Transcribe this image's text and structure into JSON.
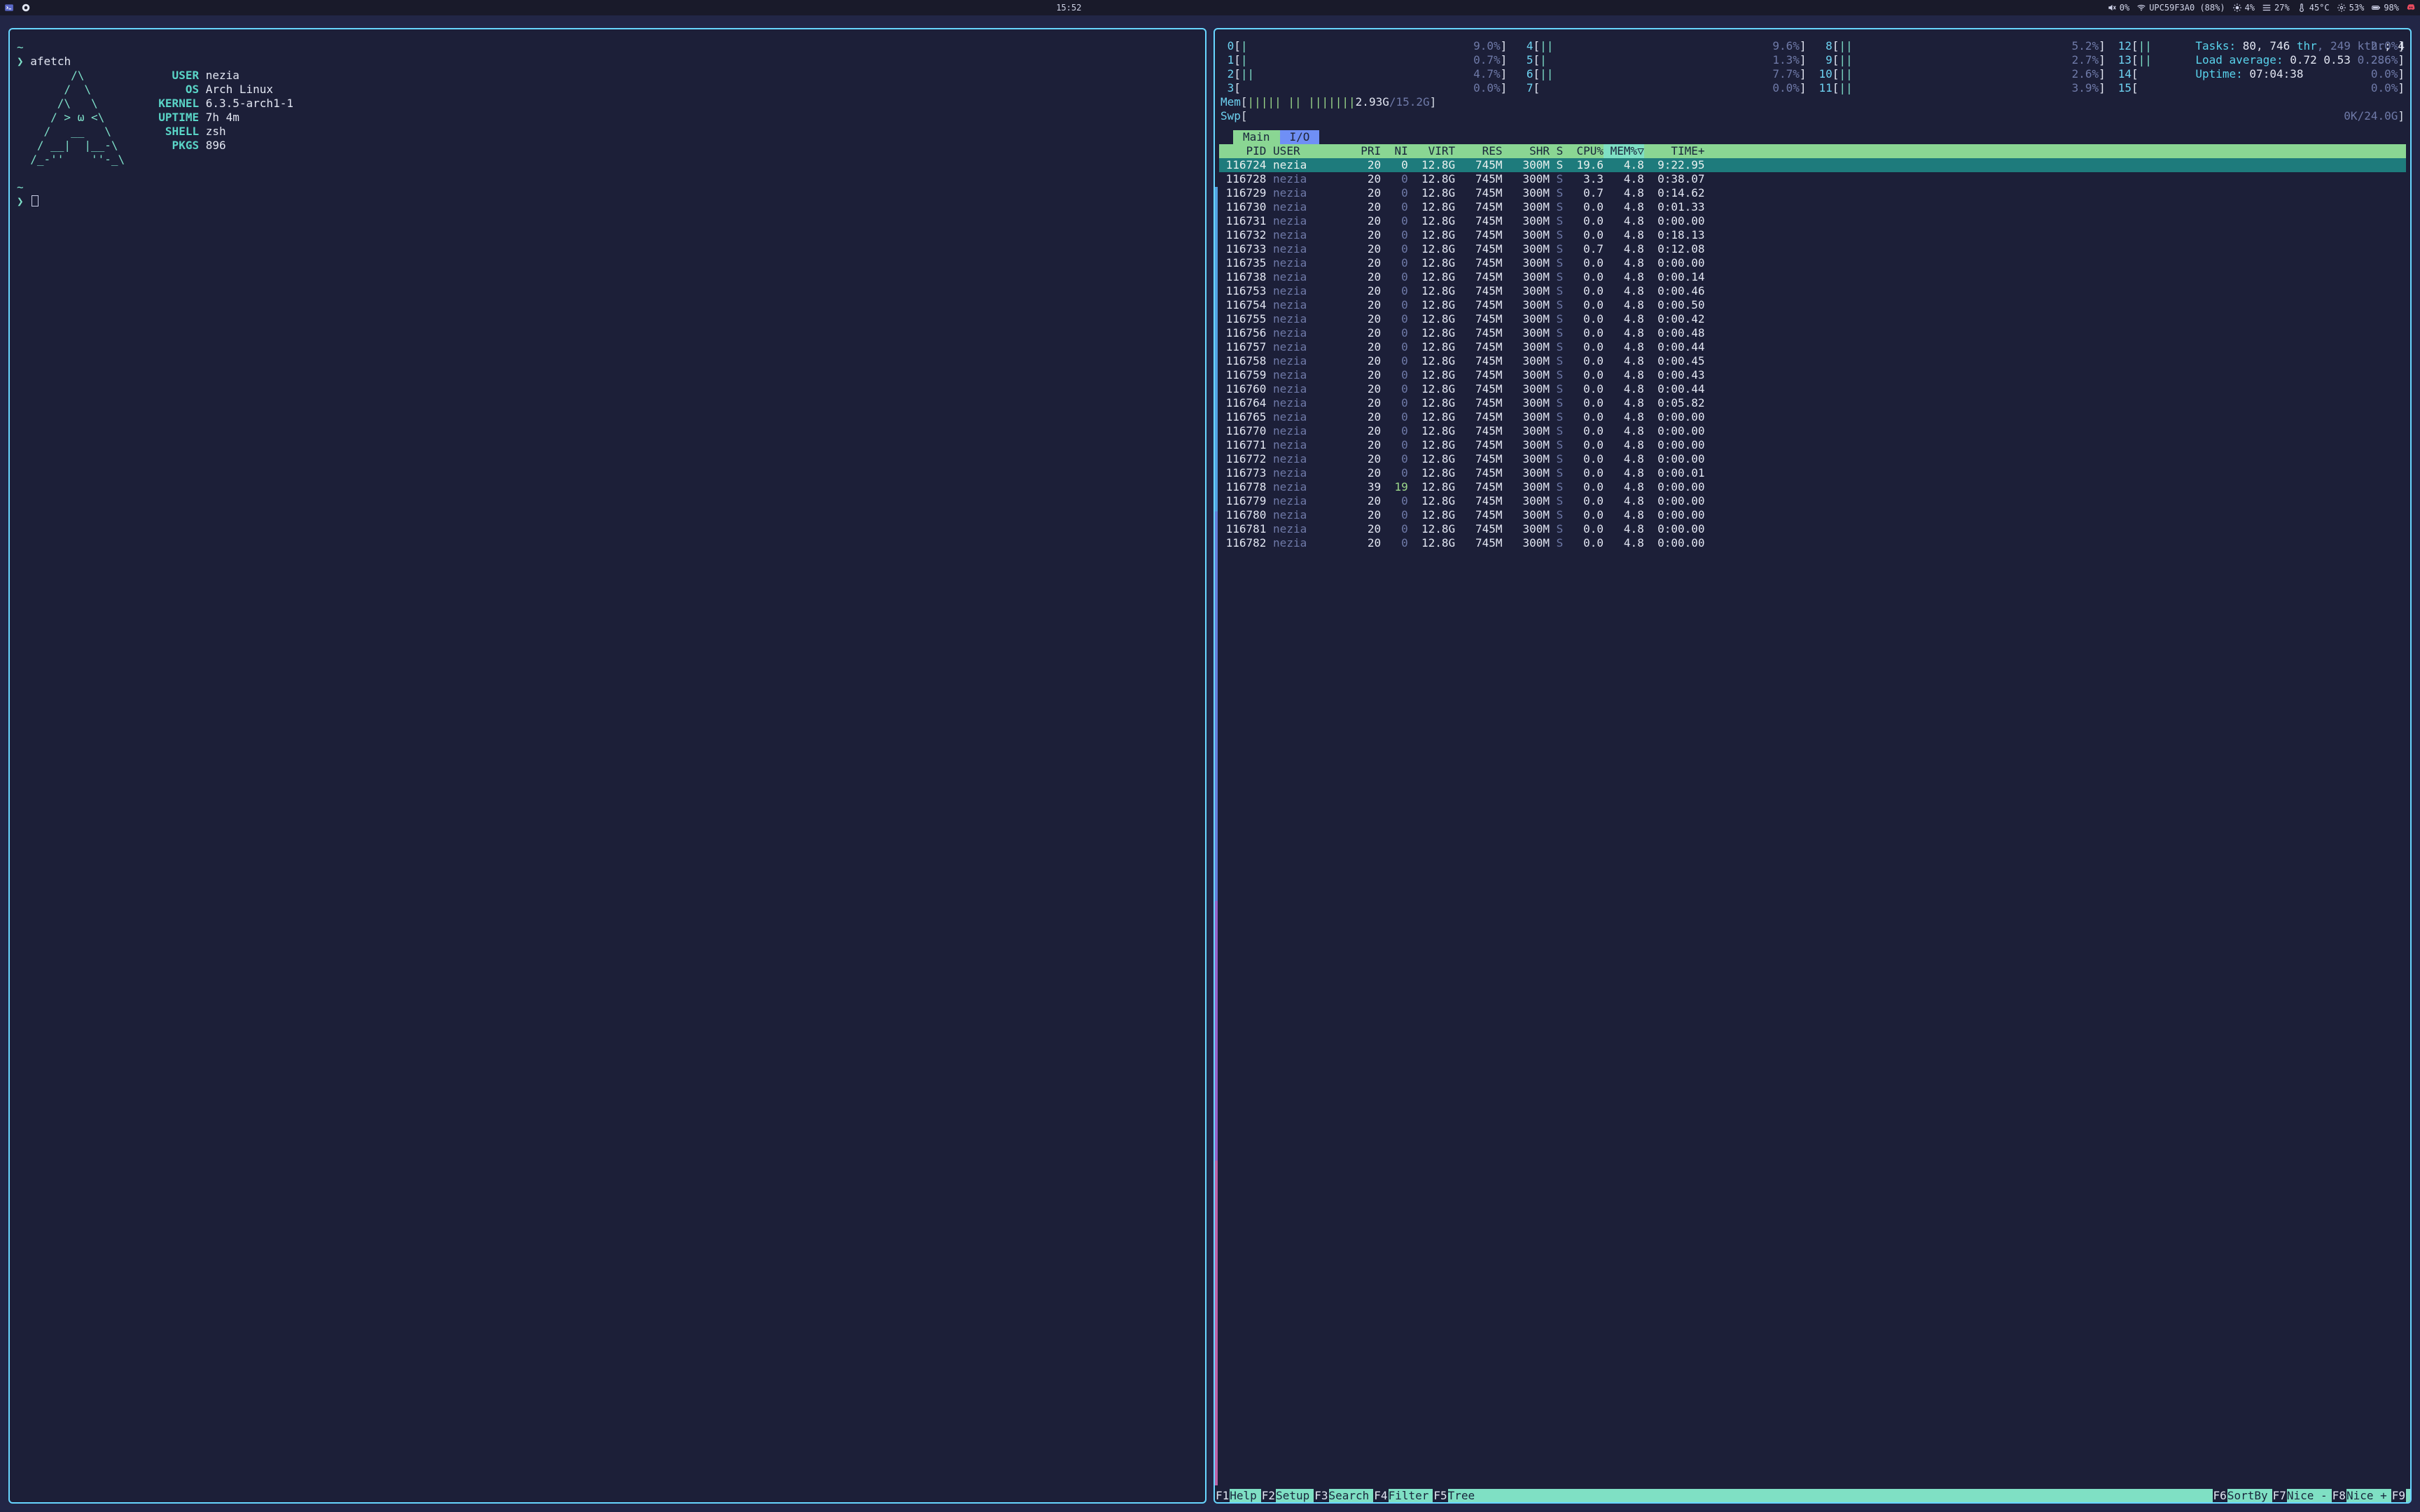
{
  "topbar": {
    "clock": "15:52",
    "volume_pct": "0%",
    "wifi": "UPC59F3A0 (88%)",
    "brightness": "4%",
    "generic_pct": "27%",
    "temp": "45°C",
    "gear_pct": "53%",
    "battery": "98%"
  },
  "left": {
    "tilde": "~",
    "prompt": "❯",
    "command": "afetch",
    "art": "        /\\\n       /  \\\n      /\\   \\\n     / > ω <\\\n    /   __   \\\n   / __|  |__-\\\n  /_-''    ''-_\\",
    "kv": [
      {
        "k": "USER",
        "v": "nezia"
      },
      {
        "k": "OS",
        "v": "Arch Linux"
      },
      {
        "k": "KERNEL",
        "v": "6.3.5-arch1-1"
      },
      {
        "k": "UPTIME",
        "v": "7h 4m"
      },
      {
        "k": "SHELL",
        "v": "zsh"
      },
      {
        "k": "PKGS",
        "v": "896"
      }
    ]
  },
  "htop": {
    "cpus": [
      {
        "n": "0",
        "bar": "|",
        "pct": "9.0%"
      },
      {
        "n": "1",
        "bar": "|",
        "pct": "0.7%"
      },
      {
        "n": "2",
        "bar": "||",
        "pct": "4.7%"
      },
      {
        "n": "3",
        "bar": "",
        "pct": "0.0%"
      },
      {
        "n": "4",
        "bar": "||",
        "pct": "9.6%"
      },
      {
        "n": "5",
        "bar": "|",
        "pct": "1.3%"
      },
      {
        "n": "6",
        "bar": "||",
        "pct": "7.7%"
      },
      {
        "n": "7",
        "bar": "",
        "pct": "0.0%"
      },
      {
        "n": "8",
        "bar": "||",
        "pct": "5.2%"
      },
      {
        "n": "9",
        "bar": "||",
        "pct": "2.7%"
      },
      {
        "n": "10",
        "bar": "||",
        "pct": "2.6%"
      },
      {
        "n": "11",
        "bar": "||",
        "pct": "3.9%"
      },
      {
        "n": "12",
        "bar": "||",
        "pct": "2.0%"
      },
      {
        "n": "13",
        "bar": "||",
        "pct": "2.6%"
      },
      {
        "n": "14",
        "bar": "",
        "pct": "0.0%"
      },
      {
        "n": "15",
        "bar": "",
        "pct": "0.0%"
      }
    ],
    "mem": {
      "lbl": "Mem",
      "bar": "||||| || |||||||",
      "used": "2.93G",
      "total": "15.2G"
    },
    "swp": {
      "lbl": "Swp",
      "used": "0K",
      "total": "24.0G"
    },
    "tasks_label": "Tasks:",
    "tasks_procs": "80",
    "tasks_thr": "746",
    "tasks_thr_lbl": "thr",
    "tasks_kthr": "249",
    "tasks_kthr_lbl": "kthr",
    "tasks_running": "4",
    "la_label": "Load average:",
    "la1": "0.72",
    "la5": "0.53",
    "la15": "0.28",
    "uptime_label": "Uptime:",
    "uptime": "07:04:38",
    "tabs": {
      "main": "Main",
      "io": "I/O"
    },
    "cols": {
      "pid": "PID",
      "user": "USER",
      "pri": "PRI",
      "ni": "NI",
      "virt": "VIRT",
      "res": "RES",
      "shr": "SHR",
      "s": "S",
      "cpu": "CPU%",
      "mem": "MEM%▽",
      "time": "TIME+"
    },
    "rows": [
      {
        "pid": "116724",
        "user": "nezia",
        "pri": "20",
        "ni": "0",
        "virt": "12.8G",
        "res": "745M",
        "shr": "300M",
        "s": "S",
        "cpu": "19.6",
        "mem": "4.8",
        "time": "9:22.95",
        "sel": true
      },
      {
        "pid": "116728",
        "user": "nezia",
        "pri": "20",
        "ni": "0",
        "virt": "12.8G",
        "res": "745M",
        "shr": "300M",
        "s": "S",
        "cpu": "3.3",
        "mem": "4.8",
        "time": "0:38.07"
      },
      {
        "pid": "116729",
        "user": "nezia",
        "pri": "20",
        "ni": "0",
        "virt": "12.8G",
        "res": "745M",
        "shr": "300M",
        "s": "S",
        "cpu": "0.7",
        "mem": "4.8",
        "time": "0:14.62"
      },
      {
        "pid": "116730",
        "user": "nezia",
        "pri": "20",
        "ni": "0",
        "virt": "12.8G",
        "res": "745M",
        "shr": "300M",
        "s": "S",
        "cpu": "0.0",
        "mem": "4.8",
        "time": "0:01.33"
      },
      {
        "pid": "116731",
        "user": "nezia",
        "pri": "20",
        "ni": "0",
        "virt": "12.8G",
        "res": "745M",
        "shr": "300M",
        "s": "S",
        "cpu": "0.0",
        "mem": "4.8",
        "time": "0:00.00"
      },
      {
        "pid": "116732",
        "user": "nezia",
        "pri": "20",
        "ni": "0",
        "virt": "12.8G",
        "res": "745M",
        "shr": "300M",
        "s": "S",
        "cpu": "0.0",
        "mem": "4.8",
        "time": "0:18.13"
      },
      {
        "pid": "116733",
        "user": "nezia",
        "pri": "20",
        "ni": "0",
        "virt": "12.8G",
        "res": "745M",
        "shr": "300M",
        "s": "S",
        "cpu": "0.7",
        "mem": "4.8",
        "time": "0:12.08"
      },
      {
        "pid": "116735",
        "user": "nezia",
        "pri": "20",
        "ni": "0",
        "virt": "12.8G",
        "res": "745M",
        "shr": "300M",
        "s": "S",
        "cpu": "0.0",
        "mem": "4.8",
        "time": "0:00.00"
      },
      {
        "pid": "116738",
        "user": "nezia",
        "pri": "20",
        "ni": "0",
        "virt": "12.8G",
        "res": "745M",
        "shr": "300M",
        "s": "S",
        "cpu": "0.0",
        "mem": "4.8",
        "time": "0:00.14"
      },
      {
        "pid": "116753",
        "user": "nezia",
        "pri": "20",
        "ni": "0",
        "virt": "12.8G",
        "res": "745M",
        "shr": "300M",
        "s": "S",
        "cpu": "0.0",
        "mem": "4.8",
        "time": "0:00.46"
      },
      {
        "pid": "116754",
        "user": "nezia",
        "pri": "20",
        "ni": "0",
        "virt": "12.8G",
        "res": "745M",
        "shr": "300M",
        "s": "S",
        "cpu": "0.0",
        "mem": "4.8",
        "time": "0:00.50"
      },
      {
        "pid": "116755",
        "user": "nezia",
        "pri": "20",
        "ni": "0",
        "virt": "12.8G",
        "res": "745M",
        "shr": "300M",
        "s": "S",
        "cpu": "0.0",
        "mem": "4.8",
        "time": "0:00.42"
      },
      {
        "pid": "116756",
        "user": "nezia",
        "pri": "20",
        "ni": "0",
        "virt": "12.8G",
        "res": "745M",
        "shr": "300M",
        "s": "S",
        "cpu": "0.0",
        "mem": "4.8",
        "time": "0:00.48"
      },
      {
        "pid": "116757",
        "user": "nezia",
        "pri": "20",
        "ni": "0",
        "virt": "12.8G",
        "res": "745M",
        "shr": "300M",
        "s": "S",
        "cpu": "0.0",
        "mem": "4.8",
        "time": "0:00.44"
      },
      {
        "pid": "116758",
        "user": "nezia",
        "pri": "20",
        "ni": "0",
        "virt": "12.8G",
        "res": "745M",
        "shr": "300M",
        "s": "S",
        "cpu": "0.0",
        "mem": "4.8",
        "time": "0:00.45"
      },
      {
        "pid": "116759",
        "user": "nezia",
        "pri": "20",
        "ni": "0",
        "virt": "12.8G",
        "res": "745M",
        "shr": "300M",
        "s": "S",
        "cpu": "0.0",
        "mem": "4.8",
        "time": "0:00.43"
      },
      {
        "pid": "116760",
        "user": "nezia",
        "pri": "20",
        "ni": "0",
        "virt": "12.8G",
        "res": "745M",
        "shr": "300M",
        "s": "S",
        "cpu": "0.0",
        "mem": "4.8",
        "time": "0:00.44"
      },
      {
        "pid": "116764",
        "user": "nezia",
        "pri": "20",
        "ni": "0",
        "virt": "12.8G",
        "res": "745M",
        "shr": "300M",
        "s": "S",
        "cpu": "0.0",
        "mem": "4.8",
        "time": "0:05.82"
      },
      {
        "pid": "116765",
        "user": "nezia",
        "pri": "20",
        "ni": "0",
        "virt": "12.8G",
        "res": "745M",
        "shr": "300M",
        "s": "S",
        "cpu": "0.0",
        "mem": "4.8",
        "time": "0:00.00"
      },
      {
        "pid": "116770",
        "user": "nezia",
        "pri": "20",
        "ni": "0",
        "virt": "12.8G",
        "res": "745M",
        "shr": "300M",
        "s": "S",
        "cpu": "0.0",
        "mem": "4.8",
        "time": "0:00.00"
      },
      {
        "pid": "116771",
        "user": "nezia",
        "pri": "20",
        "ni": "0",
        "virt": "12.8G",
        "res": "745M",
        "shr": "300M",
        "s": "S",
        "cpu": "0.0",
        "mem": "4.8",
        "time": "0:00.00"
      },
      {
        "pid": "116772",
        "user": "nezia",
        "pri": "20",
        "ni": "0",
        "virt": "12.8G",
        "res": "745M",
        "shr": "300M",
        "s": "S",
        "cpu": "0.0",
        "mem": "4.8",
        "time": "0:00.00"
      },
      {
        "pid": "116773",
        "user": "nezia",
        "pri": "20",
        "ni": "0",
        "virt": "12.8G",
        "res": "745M",
        "shr": "300M",
        "s": "S",
        "cpu": "0.0",
        "mem": "4.8",
        "time": "0:00.01"
      },
      {
        "pid": "116778",
        "user": "nezia",
        "pri": "39",
        "ni": "19",
        "virt": "12.8G",
        "res": "745M",
        "shr": "300M",
        "s": "S",
        "cpu": "0.0",
        "mem": "4.8",
        "time": "0:00.00"
      },
      {
        "pid": "116779",
        "user": "nezia",
        "pri": "20",
        "ni": "0",
        "virt": "12.8G",
        "res": "745M",
        "shr": "300M",
        "s": "S",
        "cpu": "0.0",
        "mem": "4.8",
        "time": "0:00.00"
      },
      {
        "pid": "116780",
        "user": "nezia",
        "pri": "20",
        "ni": "0",
        "virt": "12.8G",
        "res": "745M",
        "shr": "300M",
        "s": "S",
        "cpu": "0.0",
        "mem": "4.8",
        "time": "0:00.00"
      },
      {
        "pid": "116781",
        "user": "nezia",
        "pri": "20",
        "ni": "0",
        "virt": "12.8G",
        "res": "745M",
        "shr": "300M",
        "s": "S",
        "cpu": "0.0",
        "mem": "4.8",
        "time": "0:00.00"
      },
      {
        "pid": "116782",
        "user": "nezia",
        "pri": "20",
        "ni": "0",
        "virt": "12.8G",
        "res": "745M",
        "shr": "300M",
        "s": "S",
        "cpu": "0.0",
        "mem": "4.8",
        "time": "0:00.00"
      }
    ],
    "fkeys": [
      {
        "k": "F1",
        "l": "Help"
      },
      {
        "k": "F2",
        "l": "Setup"
      },
      {
        "k": "F3",
        "l": "Search"
      },
      {
        "k": "F4",
        "l": "Filter"
      },
      {
        "k": "F5",
        "l": "Tree"
      },
      {
        "k": "F6",
        "l": "SortBy"
      },
      {
        "k": "F7",
        "l": "Nice -"
      },
      {
        "k": "F8",
        "l": "Nice +"
      },
      {
        "k": "F9",
        "l": ""
      }
    ]
  }
}
